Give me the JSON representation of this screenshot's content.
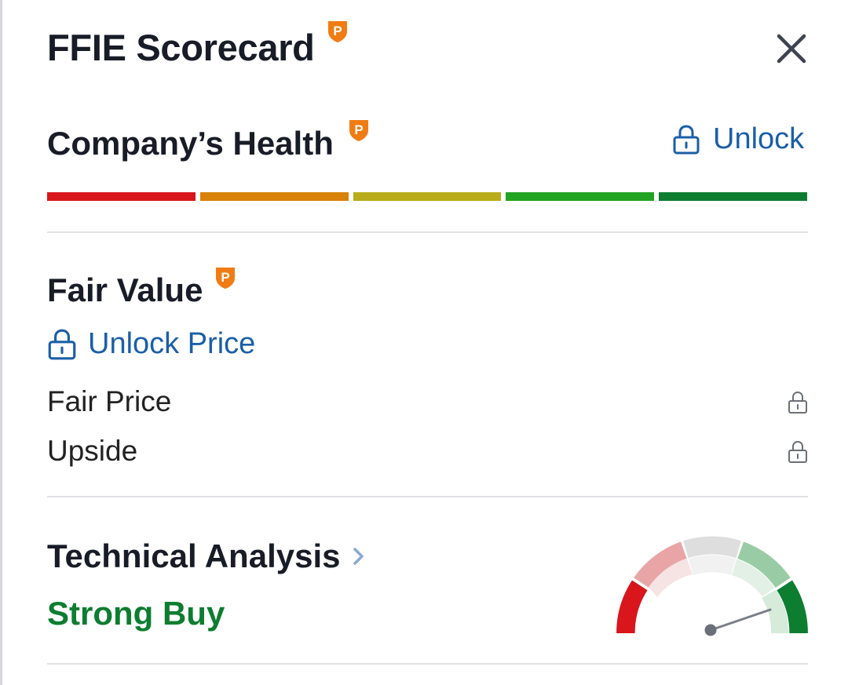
{
  "header": {
    "title": "FFIE Scorecard",
    "close_icon": "close-icon",
    "pro_icon": "pro-badge-icon"
  },
  "company_health": {
    "title": "Company’s Health",
    "unlock_label": "Unlock",
    "segment_colors": [
      "#d8161b",
      "#d9820a",
      "#b8ac1a",
      "#22a423",
      "#0d7d30"
    ]
  },
  "fair_value": {
    "title": "Fair Value",
    "unlock_price_label": "Unlock Price",
    "rows": [
      {
        "label": "Fair Price",
        "icon": "lock-icon"
      },
      {
        "label": "Upside",
        "icon": "lock-icon"
      }
    ]
  },
  "technical_analysis": {
    "title": "Technical Analysis",
    "chevron_icon": "chevron-right-icon",
    "signal": "Strong Buy",
    "signal_color": "#0d7d30",
    "gauge_level": "strong-buy"
  },
  "colors": {
    "accent_link": "#1a5fa8",
    "pro_badge": "#f07c13",
    "text": "#181c27"
  }
}
